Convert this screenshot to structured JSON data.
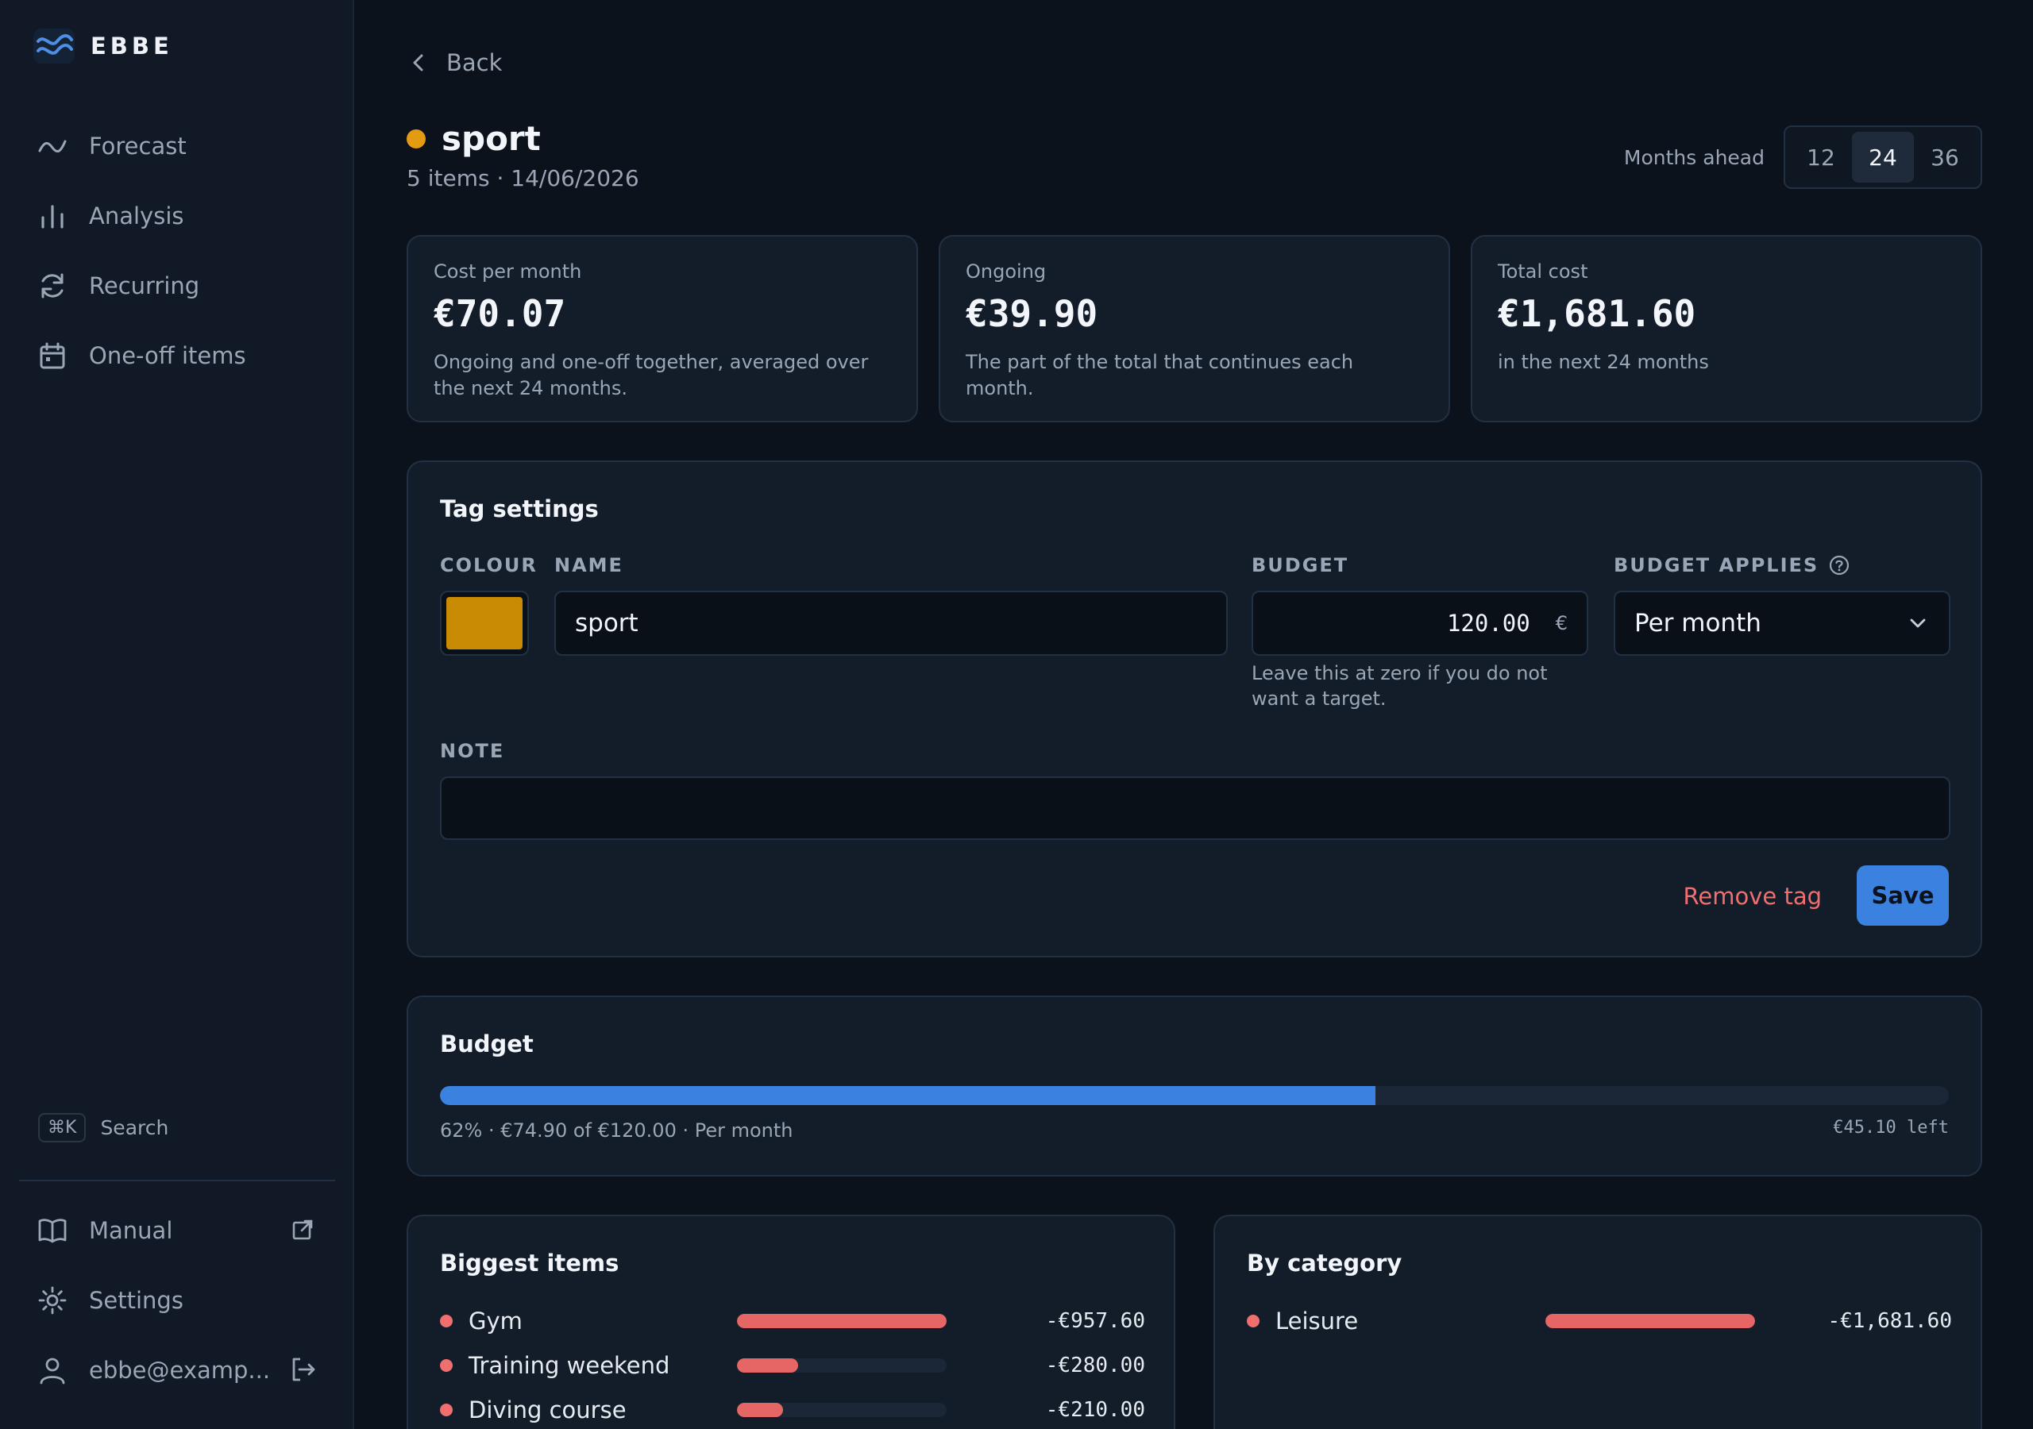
{
  "brand": {
    "name": "EBBE"
  },
  "sidebar": {
    "items": [
      {
        "label": "Forecast",
        "icon": "trend-icon"
      },
      {
        "label": "Analysis",
        "icon": "bar-chart-icon"
      },
      {
        "label": "Recurring",
        "icon": "refresh-icon"
      },
      {
        "label": "One-off items",
        "icon": "calendar-icon"
      }
    ],
    "search": {
      "shortcut": "⌘K",
      "label": "Search"
    },
    "bottom": {
      "manual": "Manual",
      "settings": "Settings",
      "user": "ebbe@examp..."
    }
  },
  "header": {
    "back": "Back",
    "title": "sport",
    "subtitle": "5 items · 14/06/2026",
    "months_label": "Months ahead",
    "months_options": [
      "12",
      "24",
      "36"
    ],
    "months_selected": "24",
    "tag_color": "#e39b12"
  },
  "stats": [
    {
      "label": "Cost per month",
      "value": "€70.07",
      "desc": "Ongoing and one-off together, averaged over the next 24 months."
    },
    {
      "label": "Ongoing",
      "value": "€39.90",
      "desc": "The part of the total that continues each month."
    },
    {
      "label": "Total cost",
      "value": "€1,681.60",
      "desc": "in the next 24 months"
    }
  ],
  "tag_settings": {
    "title": "Tag settings",
    "colour_label": "COLOUR",
    "colour_value": "#c98a04",
    "name_label": "NAME",
    "name_value": "sport",
    "budget_label": "BUDGET",
    "budget_value": "120.00",
    "budget_currency": "€",
    "budget_hint": "Leave this at zero if you do not want a target.",
    "applies_label": "BUDGET APPLIES",
    "applies_value": "Per month",
    "note_label": "NOTE",
    "note_value": "",
    "remove_label": "Remove tag",
    "save_label": "Save"
  },
  "budget": {
    "title": "Budget",
    "percent": 62,
    "caption": "62% · €74.90 of €120.00 · Per month",
    "left": "€45.10 left",
    "bar_color": "#3b82e0"
  },
  "biggest_items": {
    "title": "Biggest items",
    "rows": [
      {
        "name": "Gym",
        "amount": "-€957.60",
        "share": 100
      },
      {
        "name": "Training weekend",
        "amount": "-€280.00",
        "share": 29
      },
      {
        "name": "Diving course",
        "amount": "-€210.00",
        "share": 22
      }
    ]
  },
  "by_category": {
    "title": "By category",
    "rows": [
      {
        "name": "Leisure",
        "amount": "-€1,681.60",
        "share": 100
      }
    ]
  }
}
